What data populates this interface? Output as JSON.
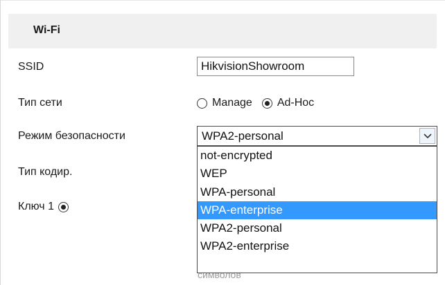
{
  "section": {
    "title": "Wi-Fi"
  },
  "ssid": {
    "label": "SSID",
    "value": "HikvisionShowroom"
  },
  "network_type": {
    "label": "Тип сети",
    "options": [
      {
        "label": "Manage",
        "checked": false
      },
      {
        "label": "Ad-Hoc",
        "checked": true
      }
    ]
  },
  "security_mode": {
    "label": "Режим безопасности",
    "selected": "WPA2-personal",
    "options": [
      "not-encrypted",
      "WEP",
      "WPA-personal",
      "WPA-enterprise",
      "WPA2-personal",
      "WPA2-enterprise"
    ],
    "highlighted": "WPA-enterprise"
  },
  "encryption_type": {
    "label": "Тип кодир."
  },
  "key1": {
    "label": "Ключ 1",
    "checked": true
  },
  "hint": {
    "text": "символов"
  },
  "colors": {
    "highlight": "#3399ff",
    "header_bg": "#f0f0f0"
  }
}
